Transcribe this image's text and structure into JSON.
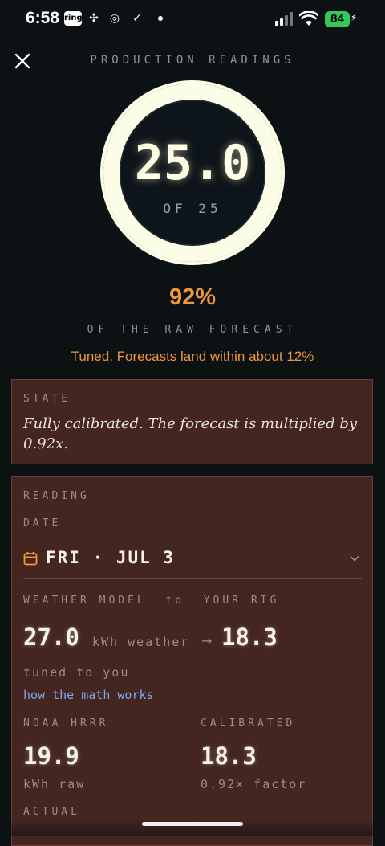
{
  "status_bar": {
    "time": "6:58",
    "ring_label": "ring",
    "battery": "84",
    "icons": [
      "ring-icon",
      "pinwheel-icon",
      "target-icon",
      "check-circle-icon",
      "dot-icon",
      "signal-icon",
      "wifi-icon",
      "battery-icon",
      "bolt-icon"
    ]
  },
  "header": {
    "title": "PRODUCTION READINGS",
    "close_icon": "close-icon"
  },
  "gauge": {
    "value": "25.0",
    "of_label": "OF 25",
    "fill_fraction": 1.0,
    "ring_color": "#fbfde6"
  },
  "summary": {
    "percent": "92%",
    "percent_caption": "OF THE RAW FORECAST",
    "tuned_text": "Tuned. Forecasts land within about 12%",
    "accent_color": "#f0963c"
  },
  "state_card": {
    "label": "STATE",
    "text": "Fully calibrated. The forecast is multiplied by 0.92x."
  },
  "reading_card": {
    "label": "READING",
    "date_label": "DATE",
    "date_value": "FRI · JUL 3",
    "model_label": "WEATHER MODEL  to  YOUR RIG",
    "weather_value": "27.0",
    "weather_unit": "kWh weather",
    "rig_value": "18.3",
    "tuned_caption": "tuned to you",
    "math_link": "how the math works",
    "noaa_label": "NOAA HRRR",
    "noaa_value": "19.9",
    "noaa_unit": "kWh raw",
    "calibrated_label": "CALIBRATED",
    "calibrated_value": "18.3",
    "calibrated_unit": "0.92× factor",
    "actual_label": "ACTUAL",
    "card_color": "#442520",
    "link_color": "#7aa9e8"
  }
}
